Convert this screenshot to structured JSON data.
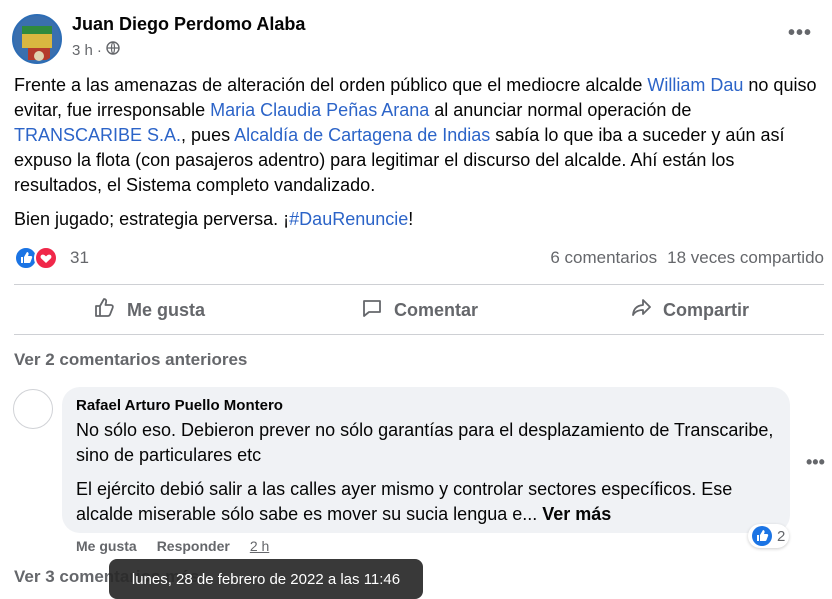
{
  "post": {
    "author": "Juan Diego Perdomo Alaba",
    "time": "3 h",
    "privacy_sep": "·",
    "more_label": "•••",
    "paragraph1": {
      "t1": "Frente a las amenazas de alteración del orden público que el mediocre alcalde ",
      "l1": "William Dau",
      "t2": " no quiso evitar, fue irresponsable ",
      "l2": "Maria Claudia Peñas Arana",
      "t3": " al anunciar normal operación de ",
      "l3": "TRANSCARIBE S.A.",
      "t4": ", pues ",
      "l4": "Alcaldía de Cartagena de Indias",
      "t5": " sabía lo que iba a suceder y aún así expuso la flota (con pasajeros adentro) para legitimar el discurso del alcalde. Ahí están los resultados, el Sistema completo vandalizado."
    },
    "paragraph2": {
      "t1": "Bien jugado; estrategia perversa. ¡",
      "l1": "#DauRenuncie",
      "t2": "!"
    },
    "reaction_count": "31",
    "comments_count": "6 comentarios",
    "shares_count": "18 veces compartido"
  },
  "actions": {
    "like": "Me gusta",
    "comment": "Comentar",
    "share": "Compartir"
  },
  "prev_comments_label": "Ver 2 comentarios anteriores",
  "comment": {
    "author": "Rafael Arturo Puello Montero",
    "para1": "No sólo eso. Debieron prever no sólo garantías para el desplazamiento de Transcaribe, sino de particulares etc",
    "para2": "El ejército debió salir a las calles ayer mismo y controlar sectores específicos. Ese alcalde miserable sólo sabe es mover su sucia lengua e... ",
    "see_more": "Ver más",
    "reaction_count": "2",
    "like": "Me gusta",
    "reply": "Responder",
    "time": "2 h",
    "more_label": "•••"
  },
  "more_comments_label": "Ver 3 comentarios más",
  "tooltip": "lunes, 28 de febrero de 2022 a las 11:46",
  "colors": {
    "link": "#2c64c8",
    "like_blue": "#1b74e4",
    "love_red": "#f0284a",
    "muted": "#65676b"
  },
  "icons": [
    "globe-icon",
    "like-icon",
    "comment-icon",
    "share-icon",
    "more-icon"
  ]
}
